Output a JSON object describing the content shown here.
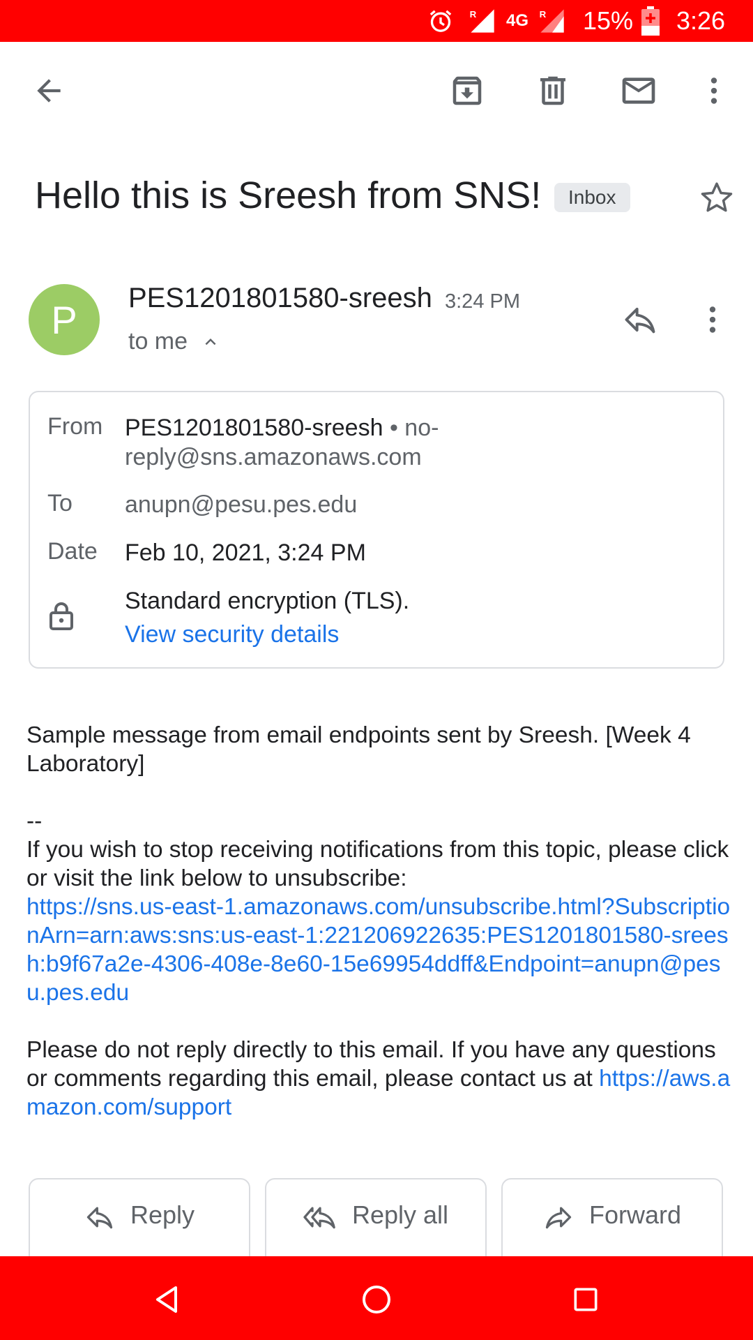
{
  "status_bar": {
    "network": "4G",
    "battery": "15%",
    "time": "3:26",
    "icons": [
      "alarm-icon",
      "signal-icon",
      "signal-icon",
      "battery-charging-icon"
    ]
  },
  "toolbar": {
    "icons": [
      "back-arrow-icon",
      "archive-icon",
      "delete-icon",
      "mark-unread-icon",
      "more-vert-icon"
    ]
  },
  "email": {
    "subject": "Hello this is Sreesh from SNS!",
    "label": "Inbox",
    "avatar_letter": "P",
    "avatar_color": "#9ccc65",
    "sender_name": "PES1201801580-sreesh",
    "time": "3:24 PM",
    "to_summary": "to me",
    "details": {
      "from_label": "From",
      "from_name": "PES1201801580-sreesh",
      "from_separator": " • ",
      "from_email": "no-reply@sns.amazonaws.com",
      "to_label": "To",
      "to_value": "anupn@pesu.pes.edu",
      "date_label": "Date",
      "date_value": "Feb 10, 2021, 3:24 PM",
      "security_text": "Standard encryption (TLS).",
      "security_link": "View security details"
    },
    "body": {
      "line1": "Sample message from email endpoints sent by Sreesh. [Week 4 Laboratory]",
      "separator": "--",
      "unsubscribe_text": "If you wish to stop receiving notifications from this topic, please click or visit the link below to unsubscribe:",
      "unsubscribe_link": "https://sns.us-east-1.amazonaws.com/unsubscribe.html?SubscriptionArn=arn:aws:sns:us-east-1:221206922635:PES1201801580-sreesh:b9f67a2e-4306-408e-8e60-15e69954ddff&Endpoint=anupn@pesu.pes.edu",
      "footer_text": "Please do not reply directly to this email. If you have any questions or comments regarding this email, please contact us at",
      "support_link": "https://aws.amazon.com/support"
    }
  },
  "actions": {
    "reply": "Reply",
    "reply_all": "Reply all",
    "forward": "Forward"
  },
  "colors": {
    "status_bar": "#ff0000",
    "link": "#1a73e8",
    "chip": "#e8eaed"
  }
}
